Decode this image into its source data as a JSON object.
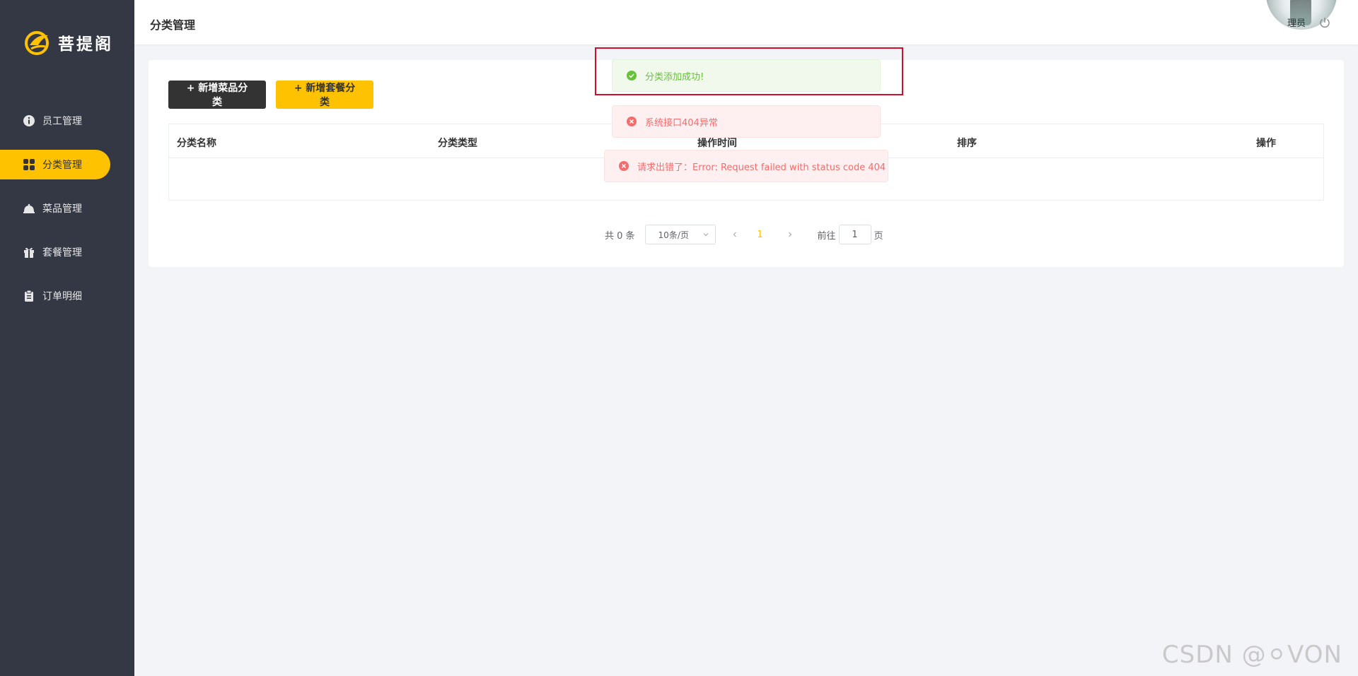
{
  "brand": {
    "name": "菩提阁",
    "accent": "#ffc200",
    "sidebar_bg": "#343744"
  },
  "sidebar": {
    "items": [
      {
        "label": "员工管理",
        "icon": "info-circle-icon",
        "active": false
      },
      {
        "label": "分类管理",
        "icon": "grid-icon",
        "active": true
      },
      {
        "label": "菜品管理",
        "icon": "dish-cover-icon",
        "active": false
      },
      {
        "label": "套餐管理",
        "icon": "gift-icon",
        "active": false
      },
      {
        "label": "订单明细",
        "icon": "clipboard-icon",
        "active": false
      }
    ]
  },
  "header": {
    "title": "分类管理",
    "user_label": "理员"
  },
  "toolbar": {
    "add_dish_category": "+ 新增菜品分类",
    "add_set_category": "+ 新增套餐分类"
  },
  "table": {
    "columns": [
      "分类名称",
      "分类类型",
      "操作时间",
      "排序",
      "操作"
    ],
    "rows": []
  },
  "pagination": {
    "total": "共 0 条",
    "page_size": "10条/页",
    "current_page": "1",
    "goto_prefix": "前往",
    "goto_value": "1",
    "goto_suffix": "页"
  },
  "messages": {
    "success": "分类添加成功!",
    "error_system": "系统接口404异常",
    "error_request": "请求出错了：Error: Request failed with status code 404"
  },
  "watermark": "CSDN @⚪VON"
}
